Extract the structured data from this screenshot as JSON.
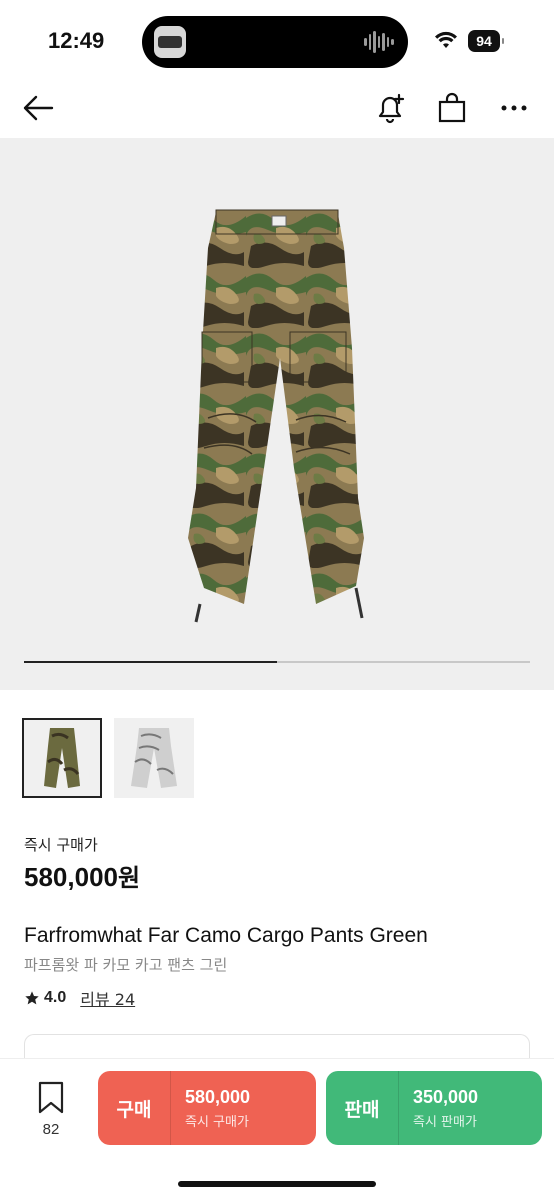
{
  "status_bar": {
    "time": "12:49",
    "battery": "94"
  },
  "nav": {
    "back_icon": "arrow-left-icon",
    "alert_icon": "bell-plus-icon",
    "cart_icon": "shopping-bag-icon",
    "more_icon": "more-horizontal-icon"
  },
  "gallery": {
    "progress": 0.5,
    "thumbnails": [
      "camo-green",
      "camo-grey"
    ],
    "selected": 0
  },
  "product": {
    "price_label": "즉시 구매가",
    "price": "580,000",
    "price_unit": "원",
    "name_en": "Farfromwhat Far Camo Cargo Pants Green",
    "name_ko": "파프롬왓 파 카모 카고 팬츠 그린",
    "rating": "4.0",
    "review_label": "리뷰 24"
  },
  "bottom_bar": {
    "wish_count": "82",
    "buy": {
      "label": "구매",
      "price": "580,000",
      "sub": "즉시 구매가",
      "color": "#ef6253"
    },
    "sell": {
      "label": "판매",
      "price": "350,000",
      "sub": "즉시 판매가",
      "color": "#41b979"
    }
  }
}
